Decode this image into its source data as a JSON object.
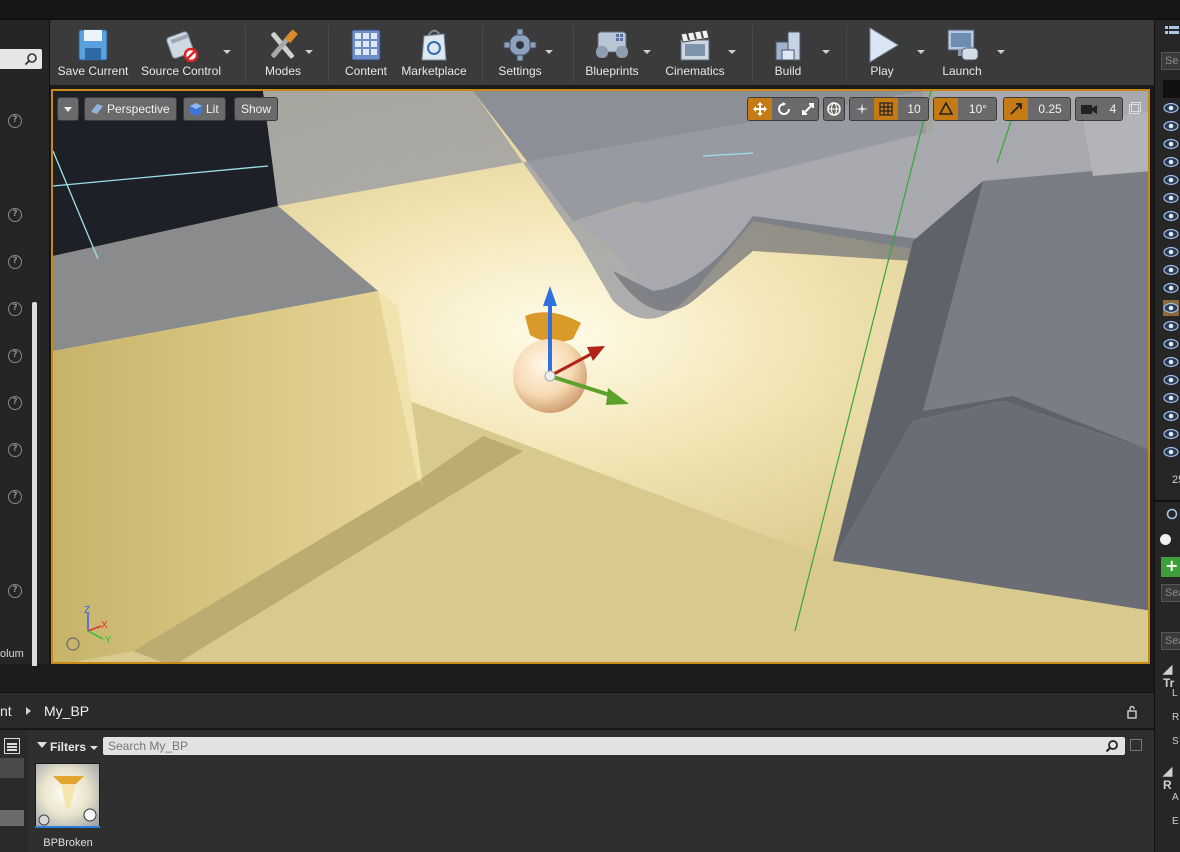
{
  "toolbar": {
    "items": [
      {
        "label": "Save Current",
        "icon": "save-icon"
      },
      {
        "label": "Source Control",
        "icon": "source-control-icon"
      },
      {
        "label": "Modes",
        "icon": "modes-icon"
      },
      {
        "label": "Content",
        "icon": "content-icon"
      },
      {
        "label": "Marketplace",
        "icon": "marketplace-icon"
      },
      {
        "label": "Settings",
        "icon": "settings-icon"
      },
      {
        "label": "Blueprints",
        "icon": "blueprints-icon"
      },
      {
        "label": "Cinematics",
        "icon": "cinematics-icon"
      },
      {
        "label": "Build",
        "icon": "build-icon"
      },
      {
        "label": "Play",
        "icon": "play-icon"
      },
      {
        "label": "Launch",
        "icon": "launch-icon"
      }
    ]
  },
  "left_panel": {
    "label": "olum",
    "help_mark": "?"
  },
  "viewport": {
    "perspective_label": "Perspective",
    "lit_label": "Lit",
    "show_label": "Show",
    "grid_snap": "10",
    "rotation_snap": "10°",
    "scale_snap": "0.25",
    "camera_speed": "4",
    "accent_color": "#c88a16",
    "axis_labels": {
      "z": "Z",
      "x": "X",
      "y": "Y"
    }
  },
  "right_panel": {
    "search_placeholder": "Se",
    "count": "25",
    "search2_placeholder": "Sea",
    "search3_placeholder": "Sea",
    "section_transform": "Tr",
    "section_rendering": "R",
    "rows": [
      "L",
      "R",
      "S",
      "A",
      "E"
    ]
  },
  "content_browser": {
    "breadcrumb_parent": "nt",
    "breadcrumb_current": "My_BP",
    "filters_label": "Filters",
    "search_placeholder": "Search My_BP",
    "asset_name": "BPBroken"
  }
}
